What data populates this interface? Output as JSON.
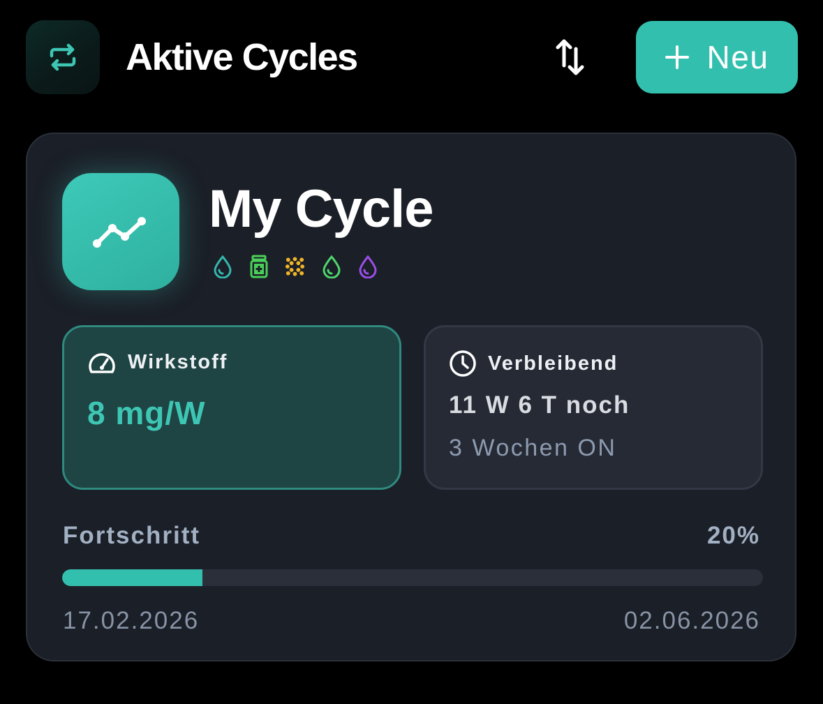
{
  "header": {
    "title": "Aktive Cycles",
    "icon": "repeat-arrows-icon",
    "sort_icon": "sort-arrows-icon",
    "new_button": {
      "icon": "plus-icon",
      "label": "Neu"
    }
  },
  "cycle": {
    "name": "My Cycle",
    "icon": "trend-line-icon",
    "compound_icons": [
      {
        "name": "drop-icon",
        "color": "#35b7ad"
      },
      {
        "name": "medicine-bottle-icon",
        "color": "#4ad05a"
      },
      {
        "name": "dots-pattern-icon",
        "color": "#f0b429"
      },
      {
        "name": "drop-icon",
        "color": "#4ed66c"
      },
      {
        "name": "drop-icon",
        "color": "#9b4ee8"
      }
    ],
    "substance": {
      "icon": "gauge-icon",
      "label": "Wirkstoff",
      "value": "8 mg/W"
    },
    "remaining": {
      "icon": "clock-icon",
      "label": "Verbleibend",
      "value": "11 W 6 T noch",
      "sub": "3 Wochen ON"
    },
    "progress": {
      "label": "Fortschritt",
      "percent_text": "20%",
      "fraction": 0.2,
      "start_date": "17.02.2026",
      "end_date": "02.06.2026"
    }
  },
  "colors": {
    "accent": "#33bfae",
    "background": "#000000",
    "card": "#1b1f27"
  }
}
